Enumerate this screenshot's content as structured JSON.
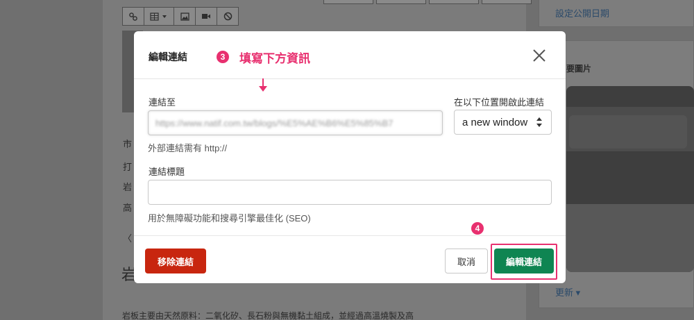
{
  "background": {
    "side_link_top": "設定公開日期",
    "side_card_title": "要圖片",
    "side_link_bottom": "更新",
    "editor_text_lines": [
      "市",
      "打",
      "岩",
      "高",
      "〈"
    ],
    "editor_heading": "岩",
    "editor_paragraph": "岩板主要由天然原料：二氧化矽、長石粉與無機黏土組成，並經過高溫燒製及高"
  },
  "modal": {
    "title": "編輯連結",
    "annotation_step3": "3",
    "annotation_step3_text": "填寫下方資訊",
    "link_to_label": "連結至",
    "url_value": "https://www.natif.com.tw/blogs/%E5%AE%B6%E5%85%B7",
    "open_in_label": "在以下位置開啟此連結",
    "open_in_value": "a new window",
    "external_link_help": "外部連結需有 http://",
    "link_title_label": "連結標題",
    "link_title_value": "",
    "seo_help": "用於無障礙功能和搜尋引擎最佳化 (SEO)",
    "annotation_step4": "4",
    "remove_label": "移除連結",
    "cancel_label": "取消",
    "edit_label": "編輯連結"
  },
  "colors": {
    "accent_annotation": "#e8306f",
    "remove_button": "#c8260f",
    "edit_button": "#0f8552"
  }
}
